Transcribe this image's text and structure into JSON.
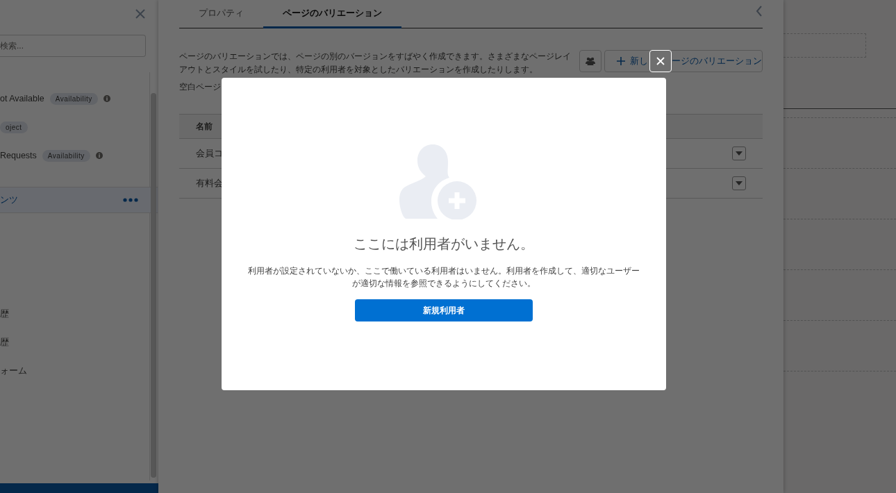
{
  "left_panel": {
    "search": {
      "placeholder": "検索..."
    },
    "items": [
      {
        "label": "ot Available",
        "badge": "Availability",
        "info": true,
        "selected": false
      },
      {
        "badge": "oject",
        "selected": false
      },
      {
        "label": "Requests",
        "badge": "Availability",
        "info": true,
        "selected": false
      },
      {
        "label": "ンツ",
        "selected": true
      },
      {
        "label": "歴",
        "selected": false
      },
      {
        "label": "歴",
        "selected": false
      },
      {
        "label": "ォーム",
        "selected": false
      }
    ]
  },
  "tabs": [
    {
      "label": "プロパティ",
      "selected": false
    },
    {
      "label": "ページのバリエーション",
      "selected": true
    }
  ],
  "description": "ページのバリエーションでは、ページの別のバージョンをすばやく作成できます。さまざまなページレイアウトとスタイルを試したり、特定の利用者を対象としたバリエーションを作成したりします。",
  "blank_page_text": "空白ページ",
  "new_variation_button": {
    "label_start": "新し",
    "label_end": "ージのバリエーション"
  },
  "table": {
    "columns": [
      "名前"
    ],
    "rows": [
      [
        "会員コ"
      ],
      [
        "有料会"
      ]
    ]
  },
  "modal": {
    "title": "ここには利用者がいません。",
    "message": "利用者が設定されていないか、ここで働いている利用者はいません。利用者を作成して、適切なユーザーが適切な情報を参照できるようにしてください。",
    "button": "新規利用者"
  }
}
